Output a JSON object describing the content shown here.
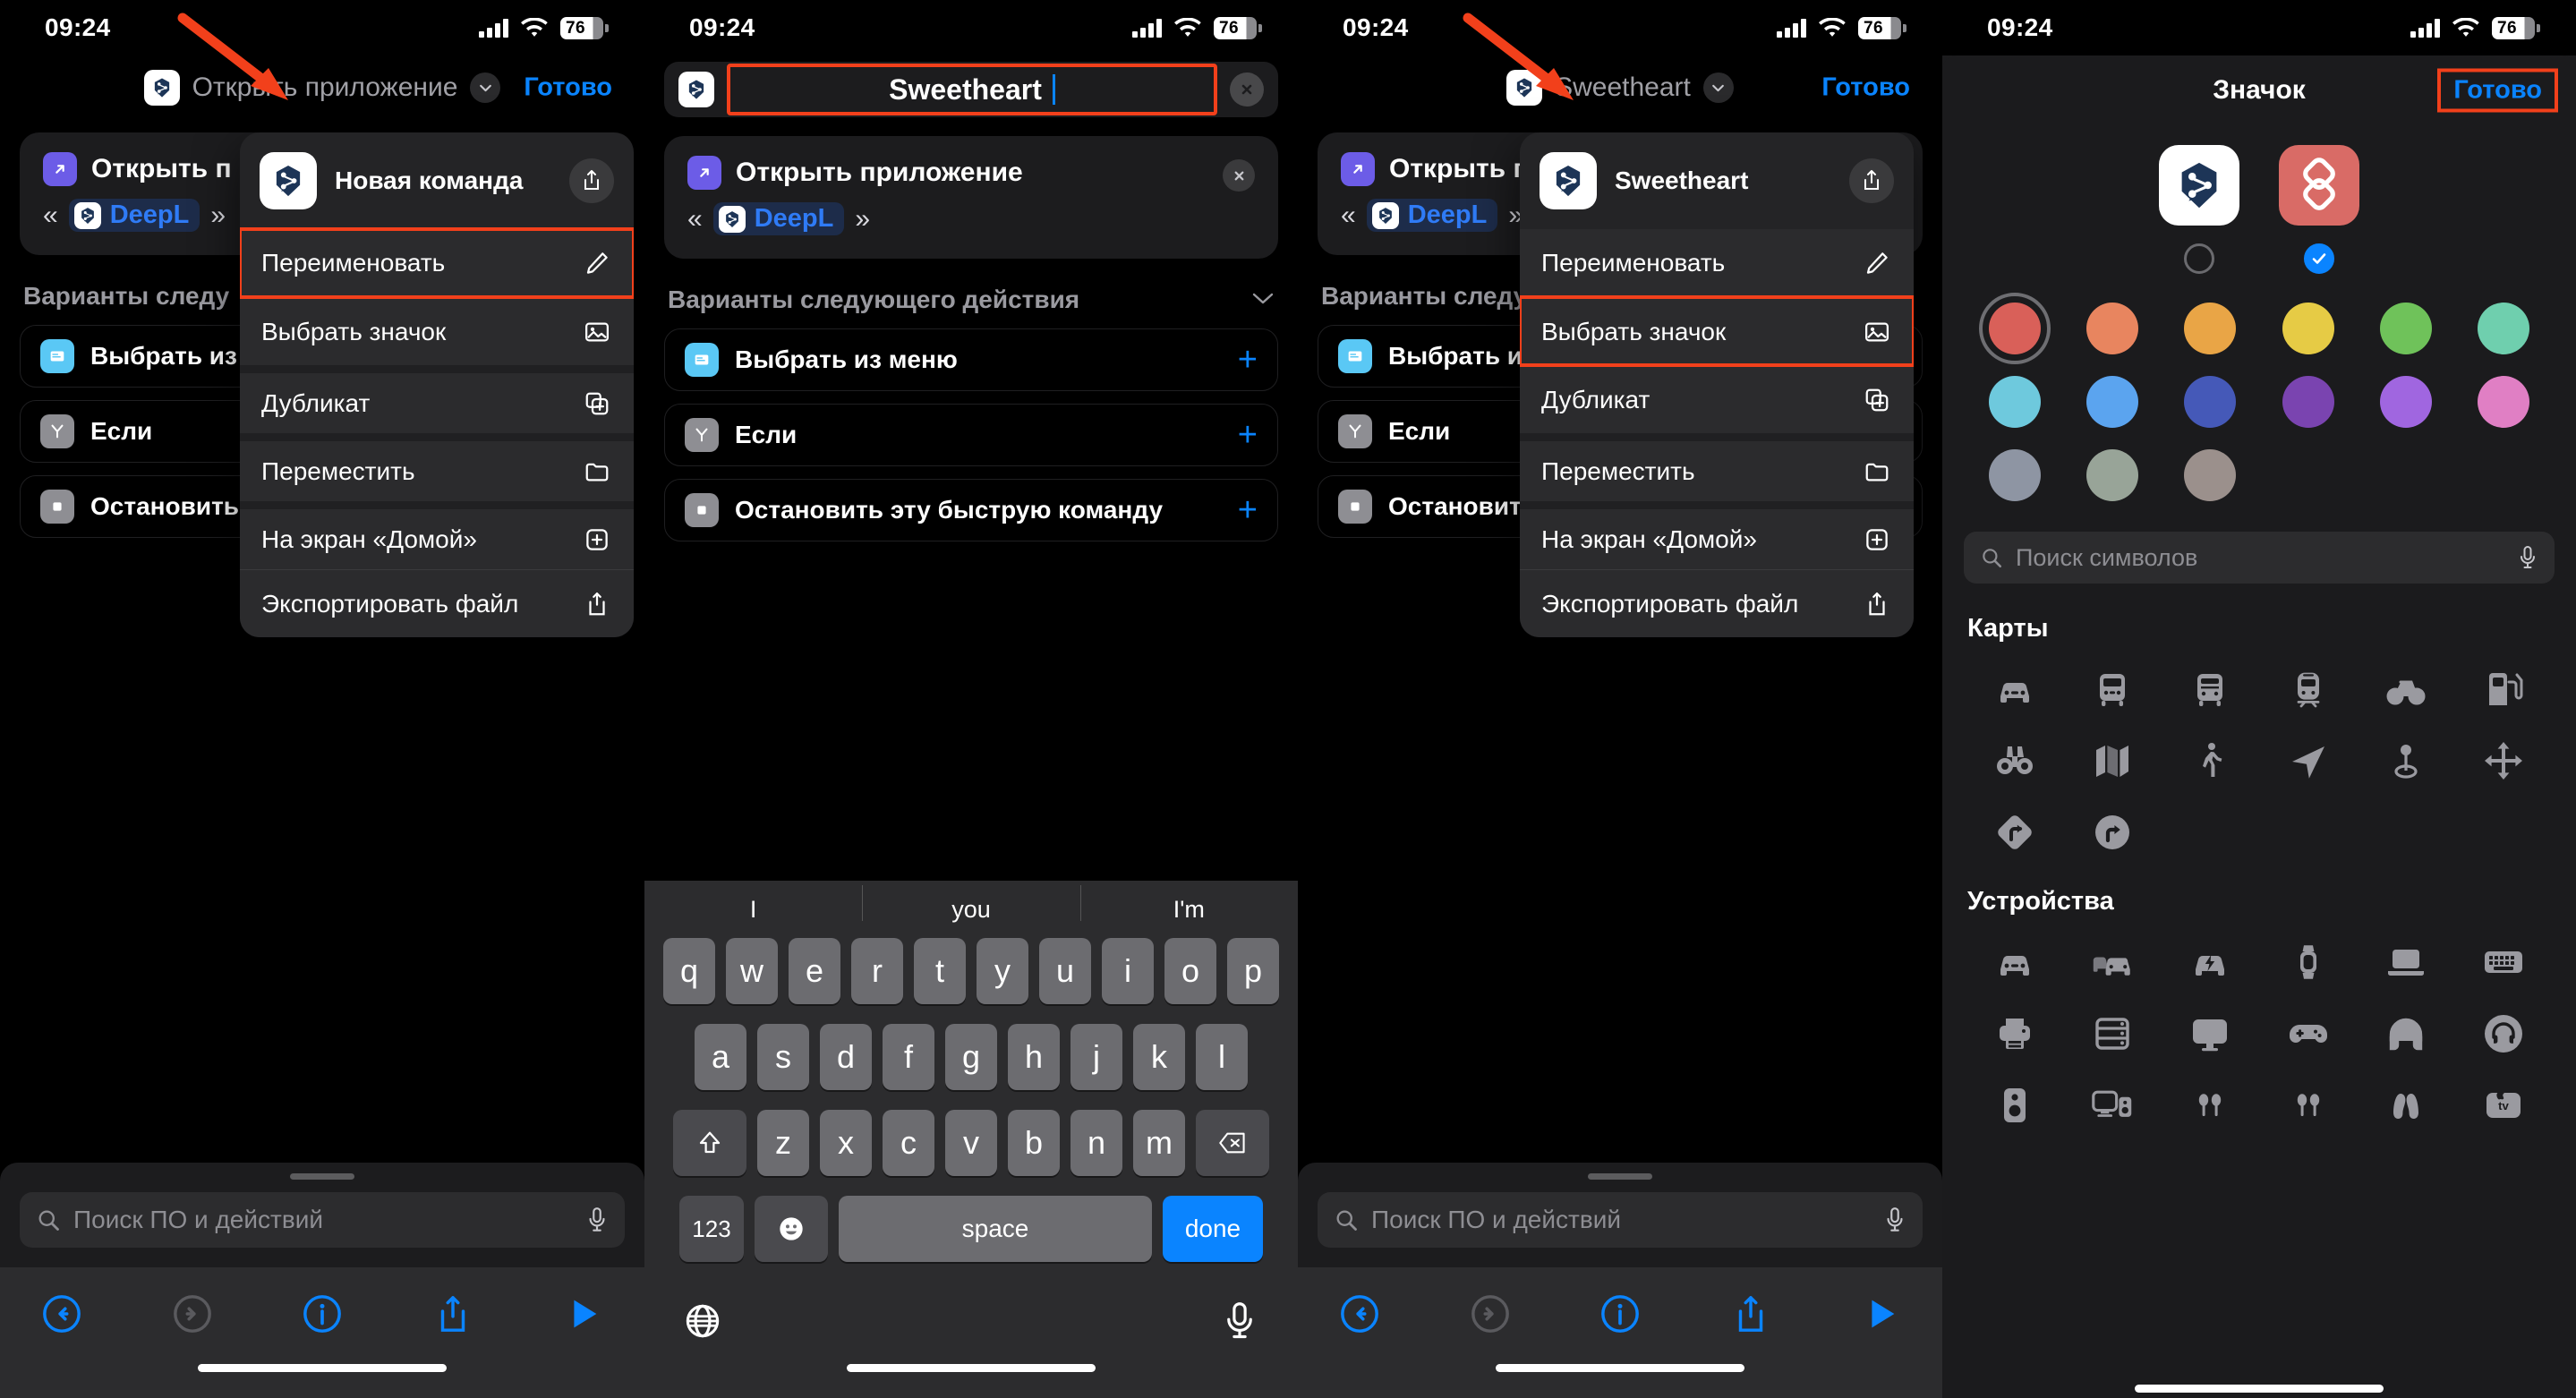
{
  "status": {
    "time": "09:24",
    "battery": "76"
  },
  "panel1": {
    "nav": {
      "title": "Открыть приложение",
      "done": "Готово"
    },
    "action": {
      "label": "Открыть п",
      "open_quote": "«",
      "close_quote": "»",
      "app": "DeepL"
    },
    "section_title": "Варианты следу",
    "suggestions": [
      {
        "label": "Выбрать из",
        "icon": "menu-icon",
        "color": "#5ac8f5"
      },
      {
        "label": "Если",
        "icon": "branch-icon",
        "color": "#8e8e93"
      },
      {
        "label": "Остановить",
        "icon": "stop-icon",
        "color": "#8e8e93"
      }
    ],
    "menu": {
      "header_title": "Новая команда",
      "items": [
        {
          "label": "Переименовать",
          "icon": "pencil-icon",
          "highlighted": true
        },
        {
          "label": "Выбрать значок",
          "icon": "photo-icon",
          "highlighted": false
        },
        {
          "label": "Дубликат",
          "icon": "duplicate-icon",
          "highlighted": false
        },
        {
          "label": "Переместить",
          "icon": "folder-icon",
          "highlighted": false
        },
        {
          "label": "На экран «Домой»",
          "icon": "plus-square-icon",
          "highlighted": false
        },
        {
          "label": "Экспортировать файл",
          "icon": "share-icon",
          "highlighted": false
        }
      ]
    },
    "search_placeholder": "Поиск ПО и действий"
  },
  "panel2": {
    "title_field": {
      "value": "Sweetheart",
      "clear": "clear-icon"
    },
    "action": {
      "label": "Открыть приложение",
      "open_quote": "«",
      "close_quote": "»",
      "app": "DeepL"
    },
    "section_title": "Варианты следующего действия",
    "suggestions": [
      {
        "label": "Выбрать из меню",
        "icon": "menu-icon",
        "color": "#5ac8f5"
      },
      {
        "label": "Если",
        "icon": "branch-icon",
        "color": "#8e8e93"
      },
      {
        "label": "Остановить эту быструю команду",
        "icon": "stop-icon",
        "color": "#8e8e93"
      }
    ],
    "keyboard": {
      "predictions": [
        "I",
        "you",
        "I'm"
      ],
      "row1": [
        "q",
        "w",
        "e",
        "r",
        "t",
        "y",
        "u",
        "i",
        "o",
        "p"
      ],
      "row2": [
        "a",
        "s",
        "d",
        "f",
        "g",
        "h",
        "j",
        "k",
        "l"
      ],
      "row3": [
        "z",
        "x",
        "c",
        "v",
        "b",
        "n",
        "m"
      ],
      "numbers_key": "123",
      "space_key": "space",
      "done_key": "done"
    }
  },
  "panel3": {
    "nav": {
      "title": "Sweetheart",
      "done": "Готово"
    },
    "action": {
      "label": "Открыть п",
      "open_quote": "«",
      "close_quote": "»",
      "app": "DeepL"
    },
    "section_title": "Варианты следу",
    "suggestions": [
      {
        "label": "Выбрать из",
        "icon": "menu-icon",
        "color": "#5ac8f5"
      },
      {
        "label": "Если",
        "icon": "branch-icon",
        "color": "#8e8e93"
      },
      {
        "label": "Остановить",
        "icon": "stop-icon",
        "color": "#8e8e93"
      }
    ],
    "menu": {
      "header_title": "Sweetheart",
      "items": [
        {
          "label": "Переименовать",
          "icon": "pencil-icon",
          "highlighted": false
        },
        {
          "label": "Выбрать значок",
          "icon": "photo-icon",
          "highlighted": true
        },
        {
          "label": "Дубликат",
          "icon": "duplicate-icon",
          "highlighted": false
        },
        {
          "label": "Переместить",
          "icon": "folder-icon",
          "highlighted": false
        },
        {
          "label": "На экран «Домой»",
          "icon": "plus-square-icon",
          "highlighted": false
        },
        {
          "label": "Экспортировать файл",
          "icon": "share-icon",
          "highlighted": false
        }
      ]
    },
    "search_placeholder": "Поиск ПО и действий"
  },
  "panel4": {
    "nav": {
      "title": "Значок",
      "done": "Готово"
    },
    "glyph_choices": [
      {
        "name": "deepl-app-glyph",
        "selected": false,
        "background": "#ffffff"
      },
      {
        "name": "layers-glyph",
        "selected": true,
        "background": "#d96b66"
      }
    ],
    "colors": [
      {
        "hex": "#d96059",
        "selected": true
      },
      {
        "hex": "#e8855f",
        "selected": false
      },
      {
        "hex": "#e9a546",
        "selected": false
      },
      {
        "hex": "#e6cb45",
        "selected": false
      },
      {
        "hex": "#6fc25a",
        "selected": false
      },
      {
        "hex": "#6fcfae",
        "selected": false
      },
      {
        "hex": "#6ec9dd",
        "selected": false
      },
      {
        "hex": "#5ba4ef",
        "selected": false
      },
      {
        "hex": "#4559b8",
        "selected": false
      },
      {
        "hex": "#7a44b0",
        "selected": false
      },
      {
        "hex": "#a濃",
        "selected": false
      },
      {
        "hex": "#e07fc4",
        "selected": false
      },
      {
        "hex": "#8e95a3",
        "selected": false
      },
      {
        "hex": "#98a498",
        "selected": false
      },
      {
        "hex": "#9b908c",
        "selected": false
      }
    ],
    "search_placeholder": "Поиск символов",
    "sections": [
      {
        "title": "Карты",
        "symbols": [
          "car-icon",
          "bus-icon",
          "tram-icon",
          "train-icon",
          "bicycle-icon",
          "fuelpump-icon",
          "binoculars-icon",
          "map-icon",
          "walk-icon",
          "location-arrow-icon",
          "mappin-icon",
          "move-arrows-icon",
          "turn-right-sign-icon",
          "turn-right-circle-icon"
        ]
      },
      {
        "title": "Устройства",
        "symbols": [
          "car-icon",
          "cars-icon",
          "car-charge-icon",
          "applewatch-icon",
          "laptop-icon",
          "keyboard-icon",
          "printer-icon",
          "server-icon",
          "display-icon",
          "gamecontroller-icon",
          "headphones-icon",
          "headphones-circle-icon",
          "speaker-icon",
          "desktop-speaker-icon",
          "earbuds-case-icon",
          "earbuds-icon",
          "airpods-icon",
          "appletv-icon"
        ]
      }
    ]
  }
}
